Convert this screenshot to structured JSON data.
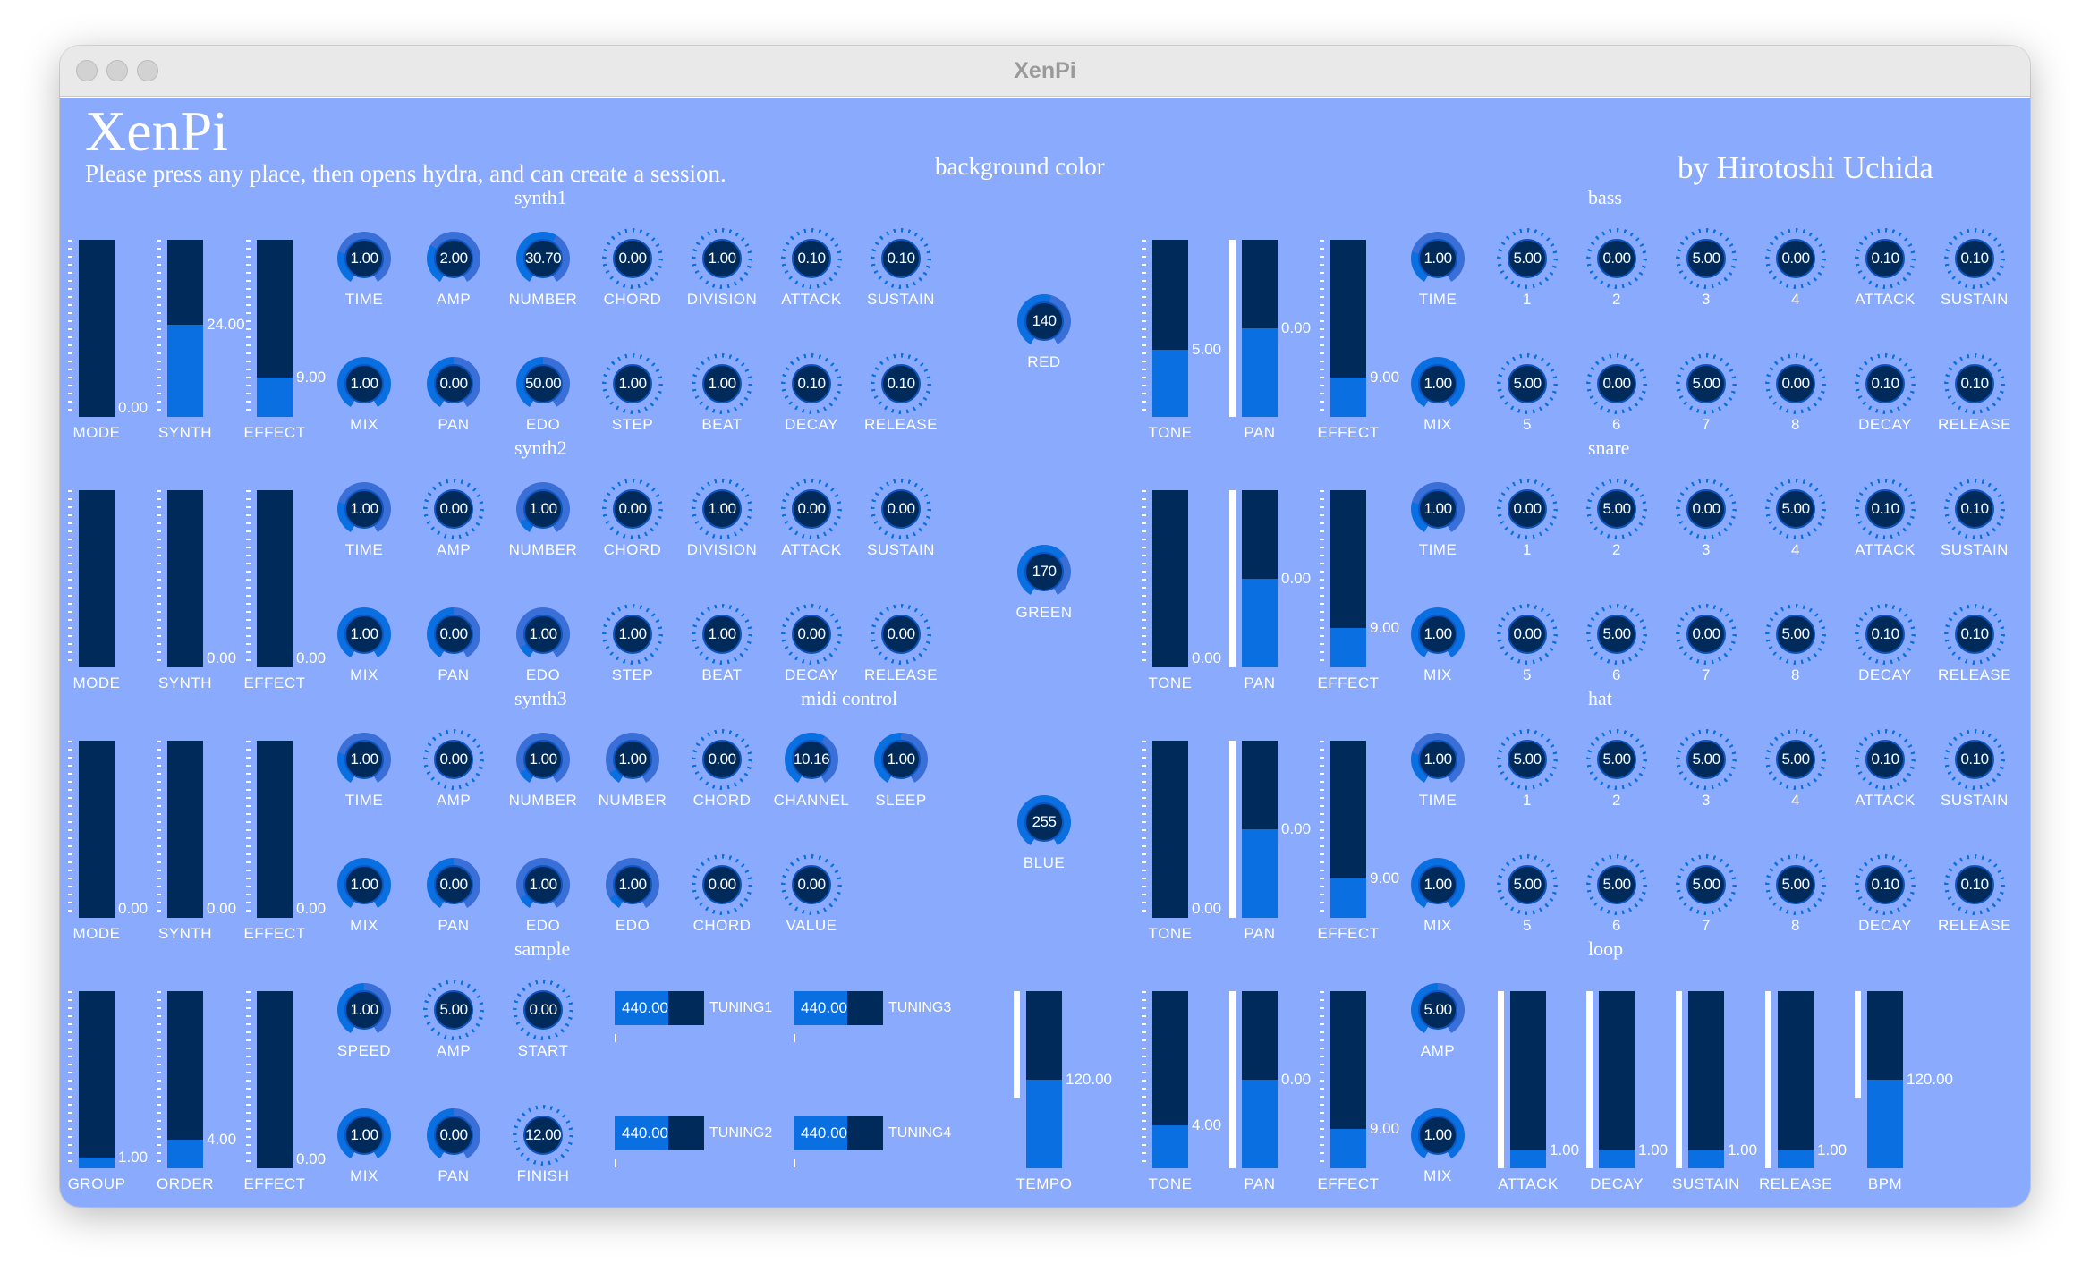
{
  "window": {
    "title": "XenPi"
  },
  "header": {
    "app_name": "XenPi",
    "subtitle": "Please press any place, then opens hydra, and can create a session.",
    "bg_label": "background color",
    "author": "by Hirotoshi Uchida"
  },
  "colors": {
    "panel": "#8aaafd",
    "dark": "#002a5a",
    "accent": "#0a6fe0"
  },
  "sections": {
    "synth1": "synth1",
    "synth2": "synth2",
    "synth3": "synth3",
    "midi": "midi control",
    "sample": "sample",
    "bass": "bass",
    "snare": "snare",
    "hat": "hat",
    "loop": "loop"
  },
  "sliders": [
    {
      "label": "MODE",
      "value": "0.00",
      "fill": 0.0
    },
    {
      "label": "SYNTH",
      "value": "24.00",
      "fill": 0.52
    },
    {
      "label": "EFFECT",
      "value": "9.00",
      "fill": 0.22
    },
    {
      "label": "MODE",
      "value": "",
      "fill": 0.0
    },
    {
      "label": "SYNTH",
      "value": "0.00",
      "fill": 0.0
    },
    {
      "label": "EFFECT",
      "value": "0.00",
      "fill": 0.0
    },
    {
      "label": "MODE",
      "value": "0.00",
      "fill": 0.0
    },
    {
      "label": "SYNTH",
      "value": "0.00",
      "fill": 0.0
    },
    {
      "label": "EFFECT",
      "value": "0.00",
      "fill": 0.0
    },
    {
      "label": "GROUP",
      "value": "1.00",
      "fill": 0.06
    },
    {
      "label": "ORDER",
      "value": "4.00",
      "fill": 0.16
    },
    {
      "label": "EFFECT",
      "value": "0.00",
      "fill": 0.0
    },
    {
      "label": "TEMPO",
      "value": "120.00",
      "fill": 0.5
    },
    {
      "label": "TONE",
      "value": "5.00",
      "fill": 0.38
    },
    {
      "label": "PAN",
      "value": "0.00",
      "fill": 0.5
    },
    {
      "label": "EFFECT",
      "value": "9.00",
      "fill": 0.22
    },
    {
      "label": "TONE",
      "value": "0.00",
      "fill": 0.0
    },
    {
      "label": "PAN",
      "value": "0.00",
      "fill": 0.5
    },
    {
      "label": "EFFECT",
      "value": "9.00",
      "fill": 0.22
    },
    {
      "label": "TONE",
      "value": "0.00",
      "fill": 0.0
    },
    {
      "label": "PAN",
      "value": "0.00",
      "fill": 0.5
    },
    {
      "label": "EFFECT",
      "value": "9.00",
      "fill": 0.22
    },
    {
      "label": "TONE",
      "value": "4.00",
      "fill": 0.24
    },
    {
      "label": "PAN",
      "value": "0.00",
      "fill": 0.5
    },
    {
      "label": "EFFECT",
      "value": "9.00",
      "fill": 0.22
    },
    {
      "label": "ATTACK",
      "value": "1.00",
      "fill": 0.1
    },
    {
      "label": "DECAY",
      "value": "1.00",
      "fill": 0.1
    },
    {
      "label": "SUSTAIN",
      "value": "1.00",
      "fill": 0.1
    },
    {
      "label": "RELEASE",
      "value": "1.00",
      "fill": 0.1
    },
    {
      "label": "BPM",
      "value": "120.00",
      "fill": 0.5
    }
  ],
  "knobs": [
    {
      "label": "TIME",
      "value": "1.00",
      "level": 0.25
    },
    {
      "label": "AMP",
      "value": "2.00",
      "level": 0.3
    },
    {
      "label": "NUMBER",
      "value": "30.70",
      "level": 0.6
    },
    {
      "label": "CHORD",
      "value": "0.00",
      "level": 0.0
    },
    {
      "label": "DIVISION",
      "value": "1.00",
      "level": 0.05
    },
    {
      "label": "ATTACK",
      "value": "0.10",
      "level": 0.05
    },
    {
      "label": "SUSTAIN",
      "value": "0.10",
      "level": 0.05
    },
    {
      "label": "MIX",
      "value": "1.00",
      "level": 1.0
    },
    {
      "label": "PAN",
      "value": "0.00",
      "level": 0.5
    },
    {
      "label": "EDO",
      "value": "50.00",
      "level": 0.5
    },
    {
      "label": "STEP",
      "value": "1.00",
      "level": 0.05
    },
    {
      "label": "BEAT",
      "value": "1.00",
      "level": 0.05
    },
    {
      "label": "DECAY",
      "value": "0.10",
      "level": 0.05
    },
    {
      "label": "RELEASE",
      "value": "0.10",
      "level": 0.05
    },
    {
      "label": "TIME",
      "value": "1.00",
      "level": 0.25
    },
    {
      "label": "AMP",
      "value": "0.00",
      "level": 0.0
    },
    {
      "label": "NUMBER",
      "value": "1.00",
      "level": 0.1
    },
    {
      "label": "CHORD",
      "value": "0.00",
      "level": 0.0
    },
    {
      "label": "DIVISION",
      "value": "1.00",
      "level": 0.05
    },
    {
      "label": "ATTACK",
      "value": "0.00",
      "level": 0.0
    },
    {
      "label": "SUSTAIN",
      "value": "0.00",
      "level": 0.0
    },
    {
      "label": "MIX",
      "value": "1.00",
      "level": 1.0
    },
    {
      "label": "PAN",
      "value": "0.00",
      "level": 0.5
    },
    {
      "label": "EDO",
      "value": "1.00",
      "level": 0.1
    },
    {
      "label": "STEP",
      "value": "1.00",
      "level": 0.05
    },
    {
      "label": "BEAT",
      "value": "1.00",
      "level": 0.05
    },
    {
      "label": "DECAY",
      "value": "0.00",
      "level": 0.0
    },
    {
      "label": "RELEASE",
      "value": "0.00",
      "level": 0.0
    },
    {
      "label": "TIME",
      "value": "1.00",
      "level": 0.25
    },
    {
      "label": "AMP",
      "value": "0.00",
      "level": 0.0
    },
    {
      "label": "NUMBER",
      "value": "1.00",
      "level": 0.1
    },
    {
      "label": "NUMBER",
      "value": "1.00",
      "level": 0.1
    },
    {
      "label": "CHORD",
      "value": "0.00",
      "level": 0.0
    },
    {
      "label": "CHANNEL",
      "value": "10.16",
      "level": 0.6
    },
    {
      "label": "SLEEP",
      "value": "1.00",
      "level": 0.5
    },
    {
      "label": "MIX",
      "value": "1.00",
      "level": 1.0
    },
    {
      "label": "PAN",
      "value": "0.00",
      "level": 0.5
    },
    {
      "label": "EDO",
      "value": "1.00",
      "level": 0.1
    },
    {
      "label": "EDO",
      "value": "1.00",
      "level": 0.1
    },
    {
      "label": "CHORD",
      "value": "0.00",
      "level": 0.0
    },
    {
      "label": "VALUE",
      "value": "0.00",
      "level": 0.0
    },
    {
      "label": "SPEED",
      "value": "1.00",
      "level": 0.5
    },
    {
      "label": "AMP",
      "value": "5.00",
      "level": 0.0
    },
    {
      "label": "START",
      "value": "0.00",
      "level": 0.0
    },
    {
      "label": "MIX",
      "value": "1.00",
      "level": 1.0
    },
    {
      "label": "PAN",
      "value": "0.00",
      "level": 0.5
    },
    {
      "label": "FINISH",
      "value": "12.00",
      "level": 0.05
    },
    {
      "label": "RED",
      "value": "140",
      "level": 0.55
    },
    {
      "label": "GREEN",
      "value": "170",
      "level": 0.67
    },
    {
      "label": "BLUE",
      "value": "255",
      "level": 1.0
    },
    {
      "label": "TIME",
      "value": "1.00",
      "level": 0.25
    },
    {
      "label": "1",
      "value": "5.00",
      "level": 0.0
    },
    {
      "label": "2",
      "value": "0.00",
      "level": 0.0
    },
    {
      "label": "3",
      "value": "5.00",
      "level": 0.0
    },
    {
      "label": "4",
      "value": "0.00",
      "level": 0.0
    },
    {
      "label": "ATTACK",
      "value": "0.10",
      "level": 0.05
    },
    {
      "label": "SUSTAIN",
      "value": "0.10",
      "level": 0.05
    },
    {
      "label": "MIX",
      "value": "1.00",
      "level": 1.0
    },
    {
      "label": "5",
      "value": "5.00",
      "level": 0.0
    },
    {
      "label": "6",
      "value": "0.00",
      "level": 0.0
    },
    {
      "label": "7",
      "value": "5.00",
      "level": 0.0
    },
    {
      "label": "8",
      "value": "0.00",
      "level": 0.0
    },
    {
      "label": "DECAY",
      "value": "0.10",
      "level": 0.05
    },
    {
      "label": "RELEASE",
      "value": "0.10",
      "level": 0.05
    },
    {
      "label": "TIME",
      "value": "1.00",
      "level": 0.25
    },
    {
      "label": "1",
      "value": "0.00",
      "level": 0.0
    },
    {
      "label": "2",
      "value": "5.00",
      "level": 0.0
    },
    {
      "label": "3",
      "value": "0.00",
      "level": 0.0
    },
    {
      "label": "4",
      "value": "5.00",
      "level": 0.0
    },
    {
      "label": "ATTACK",
      "value": "0.10",
      "level": 0.05
    },
    {
      "label": "SUSTAIN",
      "value": "0.10",
      "level": 0.05
    },
    {
      "label": "MIX",
      "value": "1.00",
      "level": 1.0
    },
    {
      "label": "5",
      "value": "0.00",
      "level": 0.0
    },
    {
      "label": "6",
      "value": "5.00",
      "level": 0.0
    },
    {
      "label": "7",
      "value": "0.00",
      "level": 0.0
    },
    {
      "label": "8",
      "value": "5.00",
      "level": 0.0
    },
    {
      "label": "DECAY",
      "value": "0.10",
      "level": 0.05
    },
    {
      "label": "RELEASE",
      "value": "0.10",
      "level": 0.05
    },
    {
      "label": "TIME",
      "value": "1.00",
      "level": 0.25
    },
    {
      "label": "1",
      "value": "5.00",
      "level": 0.0
    },
    {
      "label": "2",
      "value": "5.00",
      "level": 0.0
    },
    {
      "label": "3",
      "value": "5.00",
      "level": 0.0
    },
    {
      "label": "4",
      "value": "5.00",
      "level": 0.0
    },
    {
      "label": "ATTACK",
      "value": "0.10",
      "level": 0.05
    },
    {
      "label": "SUSTAIN",
      "value": "0.10",
      "level": 0.05
    },
    {
      "label": "MIX",
      "value": "1.00",
      "level": 1.0
    },
    {
      "label": "5",
      "value": "5.00",
      "level": 0.0
    },
    {
      "label": "6",
      "value": "5.00",
      "level": 0.0
    },
    {
      "label": "7",
      "value": "5.00",
      "level": 0.0
    },
    {
      "label": "8",
      "value": "5.00",
      "level": 0.0
    },
    {
      "label": "DECAY",
      "value": "0.10",
      "level": 0.05
    },
    {
      "label": "RELEASE",
      "value": "0.10",
      "level": 0.05
    },
    {
      "label": "AMP",
      "value": "5.00",
      "level": 0.5
    },
    {
      "label": "MIX",
      "value": "1.00",
      "level": 1.0
    }
  ],
  "tunings": [
    {
      "label": "TUNING1",
      "value": "440.00",
      "fill": 0.6
    },
    {
      "label": "TUNING3",
      "value": "440.00",
      "fill": 0.6
    },
    {
      "label": "TUNING2",
      "value": "440.00",
      "fill": 0.6
    },
    {
      "label": "TUNING4",
      "value": "440.00",
      "fill": 0.6
    }
  ]
}
